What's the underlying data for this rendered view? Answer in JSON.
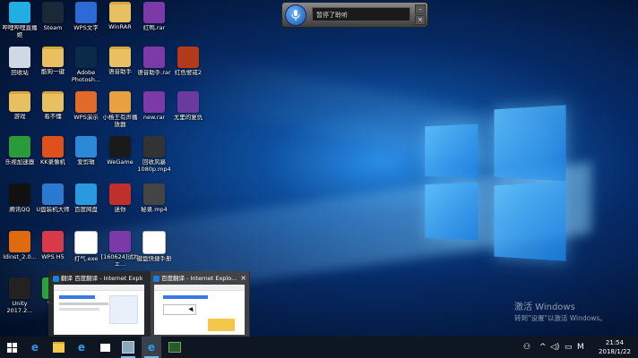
{
  "speech_widget": {
    "status_text": "暂停了聆听",
    "minimize_label": "–",
    "close_label": "×"
  },
  "desktop_icons": [
    {
      "label": "哔哩哔哩直播姬",
      "icon": "bilibili-icon",
      "color": "#23ade5"
    },
    {
      "label": "Steam",
      "icon": "steam-icon",
      "color": "#1b2838"
    },
    {
      "label": "WPS文字",
      "icon": "wps-writer-icon",
      "color": "#2c6bd6"
    },
    {
      "label": "WinRAR",
      "icon": "folder-icon",
      "color": "#e8c062"
    },
    {
      "label": "红鸭.rar",
      "icon": "rar-archive-icon",
      "color": "#7b3aa8"
    },
    {
      "label": "回收站",
      "icon": "recycle-bin-icon",
      "color": "#cfd8e3"
    },
    {
      "label": "酷狗一键",
      "icon": "folder-icon",
      "color": "#e8c062"
    },
    {
      "label": "Adobe Photosh...",
      "icon": "photoshop-icon",
      "color": "#0b2a4a"
    },
    {
      "label": "语音助手",
      "icon": "folder-icon",
      "color": "#e8c062"
    },
    {
      "label": "语音助手.rar",
      "icon": "rar-archive-icon",
      "color": "#7b3aa8"
    },
    {
      "label": "红色警戒2",
      "icon": "red-alert-icon",
      "color": "#b23a1a"
    },
    {
      "label": "游戏",
      "icon": "folder-icon",
      "color": "#e8c062"
    },
    {
      "label": "看不懂",
      "icon": "folder-icon",
      "color": "#e8c062"
    },
    {
      "label": "WPS演示",
      "icon": "wps-presentation-icon",
      "color": "#e06a2a"
    },
    {
      "label": "小杨王有声播放器",
      "icon": "apk-icon",
      "color": "#e8a040"
    },
    {
      "label": "new.rar",
      "icon": "rar-archive-icon",
      "color": "#7b3aa8"
    },
    {
      "label": "尤里的复仇",
      "icon": "yuri-icon",
      "color": "#6a3aa0"
    },
    {
      "label": "乐视加速器",
      "icon": "accelerator-icon",
      "color": "#2a9a3a"
    },
    {
      "label": "KK录像机",
      "icon": "kk-recorder-icon",
      "color": "#e0501a"
    },
    {
      "label": "爱剪辑",
      "icon": "editor-icon",
      "color": "#2a8ad8"
    },
    {
      "label": "WeGame",
      "icon": "wegame-icon",
      "color": "#1a1a1a"
    },
    {
      "label": "回收风暴1080p.mp4",
      "icon": "video-file-icon",
      "color": "#333333"
    },
    {
      "label": "腾讯QQ",
      "icon": "qq-icon",
      "color": "#111111"
    },
    {
      "label": "U盘装机大师",
      "icon": "usb-icon",
      "color": "#2a7ad0"
    },
    {
      "label": "百度网盘",
      "icon": "baidu-netdisk-icon",
      "color": "#2a9ae0"
    },
    {
      "label": "迷你",
      "icon": "rar-archive-icon",
      "color": "#c0302a"
    },
    {
      "label": "秘录.mp4",
      "icon": "video-file-icon",
      "color": "#444444"
    },
    {
      "label": "ldinst_2.0...",
      "icon": "installer-icon",
      "color": "#e06a10"
    },
    {
      "label": "WPS H5",
      "icon": "wps-h5-icon",
      "color": "#d83a4a"
    },
    {
      "label": "打气.exe",
      "icon": "exe-file-icon",
      "color": "#ffffff"
    },
    {
      "label": "[160624]试ねエ...",
      "icon": "rar-archive-icon",
      "color": "#7b3aa8"
    },
    {
      "label": "键盘快捷手册",
      "icon": "text-file-icon",
      "color": "#ffffff"
    },
    {
      "label": "Unity 2017.2...",
      "icon": "unity-icon",
      "color": "#222222"
    },
    {
      "label": "W...",
      "icon": "wechat-icon",
      "color": "#2aa33a"
    }
  ],
  "thumbnails": [
    {
      "title": "翻译 百度翻译 - Internet Explo...",
      "close": "×"
    },
    {
      "title": "百度翻译 - Internet Explo...",
      "close": "×"
    }
  ],
  "watermark": {
    "line1": "激活 Windows",
    "line2": "转到\"设置\"以激活 Windows。"
  },
  "taskbar": {
    "start_icon": "windows-start-icon",
    "items": [
      "edge-icon",
      "file-explorer-icon",
      "internet-explorer-icon",
      "folder-icon",
      "speech-recognition-icon",
      "internet-explorer-icon",
      "recorder-icon"
    ],
    "tray": {
      "ime_label": "M",
      "time": "21:54",
      "date": "2018/1/22"
    }
  }
}
